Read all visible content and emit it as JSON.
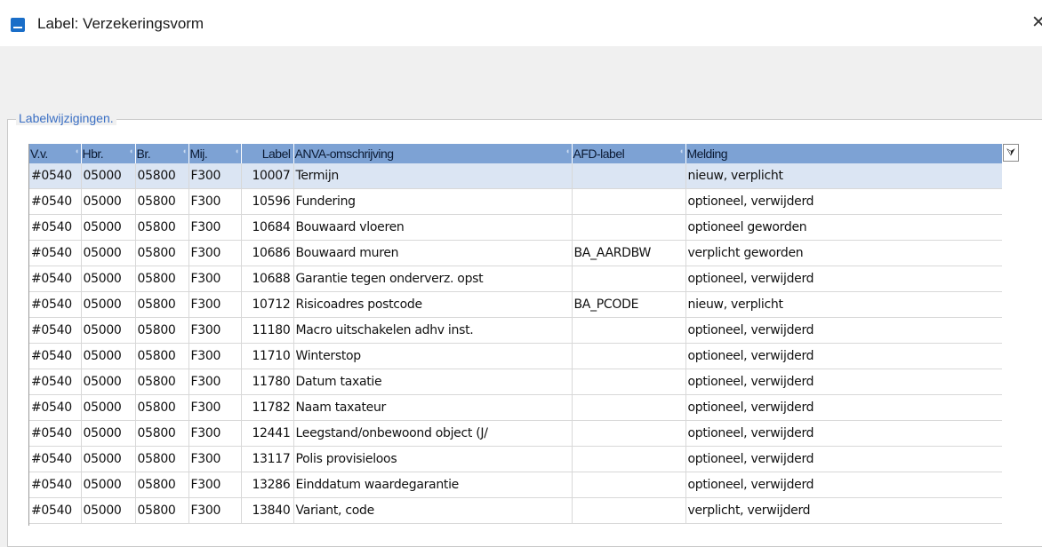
{
  "window": {
    "title": "Label: Verzekeringsvorm",
    "close_glyph": "✕",
    "app_icon": "anva-app-icon"
  },
  "group": {
    "legend": "Labelwijzigingen."
  },
  "grid": {
    "columns": [
      {
        "label": "V.v."
      },
      {
        "label": "Hbr."
      },
      {
        "label": "Br."
      },
      {
        "label": "Mij."
      },
      {
        "label": "Label"
      },
      {
        "label": "ANVA-omschrijving"
      },
      {
        "label": "AFD-label"
      },
      {
        "label": "Melding"
      }
    ],
    "menu_icon": "grid-options-icon",
    "selected_row": 0,
    "rows": [
      {
        "vv": "#0540",
        "hbr": "05000",
        "br": "05800",
        "mij": "F300",
        "label": "10007",
        "omschrijving": "Termijn",
        "afd": "",
        "melding": "nieuw, verplicht"
      },
      {
        "vv": "#0540",
        "hbr": "05000",
        "br": "05800",
        "mij": "F300",
        "label": "10596",
        "omschrijving": "Fundering",
        "afd": "",
        "melding": "optioneel, verwijderd"
      },
      {
        "vv": "#0540",
        "hbr": "05000",
        "br": "05800",
        "mij": "F300",
        "label": "10684",
        "omschrijving": "Bouwaard vloeren",
        "afd": "",
        "melding": "optioneel geworden"
      },
      {
        "vv": "#0540",
        "hbr": "05000",
        "br": "05800",
        "mij": "F300",
        "label": "10686",
        "omschrijving": "Bouwaard muren",
        "afd": "BA_AARDBW",
        "melding": "verplicht geworden"
      },
      {
        "vv": "#0540",
        "hbr": "05000",
        "br": "05800",
        "mij": "F300",
        "label": "10688",
        "omschrijving": "Garantie tegen onderverz. opst",
        "afd": "",
        "melding": "optioneel, verwijderd"
      },
      {
        "vv": "#0540",
        "hbr": "05000",
        "br": "05800",
        "mij": "F300",
        "label": "10712",
        "omschrijving": "Risicoadres postcode",
        "afd": "BA_PCODE",
        "melding": "nieuw, verplicht"
      },
      {
        "vv": "#0540",
        "hbr": "05000",
        "br": "05800",
        "mij": "F300",
        "label": "11180",
        "omschrijving": "Macro uitschakelen adhv inst.",
        "afd": "",
        "melding": "optioneel, verwijderd"
      },
      {
        "vv": "#0540",
        "hbr": "05000",
        "br": "05800",
        "mij": "F300",
        "label": "11710",
        "omschrijving": "Winterstop",
        "afd": "",
        "melding": "optioneel, verwijderd"
      },
      {
        "vv": "#0540",
        "hbr": "05000",
        "br": "05800",
        "mij": "F300",
        "label": "11780",
        "omschrijving": "Datum taxatie",
        "afd": "",
        "melding": "optioneel, verwijderd"
      },
      {
        "vv": "#0540",
        "hbr": "05000",
        "br": "05800",
        "mij": "F300",
        "label": "11782",
        "omschrijving": "Naam taxateur",
        "afd": "",
        "melding": "optioneel, verwijderd"
      },
      {
        "vv": "#0540",
        "hbr": "05000",
        "br": "05800",
        "mij": "F300",
        "label": "12441",
        "omschrijving": "Leegstand/onbewoond object (J/",
        "afd": "",
        "melding": "optioneel, verwijderd"
      },
      {
        "vv": "#0540",
        "hbr": "05000",
        "br": "05800",
        "mij": "F300",
        "label": "13117",
        "omschrijving": "Polis provisieloos",
        "afd": "",
        "melding": "optioneel, verwijderd"
      },
      {
        "vv": "#0540",
        "hbr": "05000",
        "br": "05800",
        "mij": "F300",
        "label": "13286",
        "omschrijving": "Einddatum waardegarantie",
        "afd": "",
        "melding": "optioneel, verwijderd"
      },
      {
        "vv": "#0540",
        "hbr": "05000",
        "br": "05800",
        "mij": "F300",
        "label": "13840",
        "omschrijving": "Variant, code",
        "afd": "",
        "melding": "verplicht, verwijderd"
      }
    ]
  },
  "colors": {
    "header_bg": "#7da2d4",
    "selected_row_bg": "#dbe5f3",
    "legend_text": "#3a6fc4"
  }
}
